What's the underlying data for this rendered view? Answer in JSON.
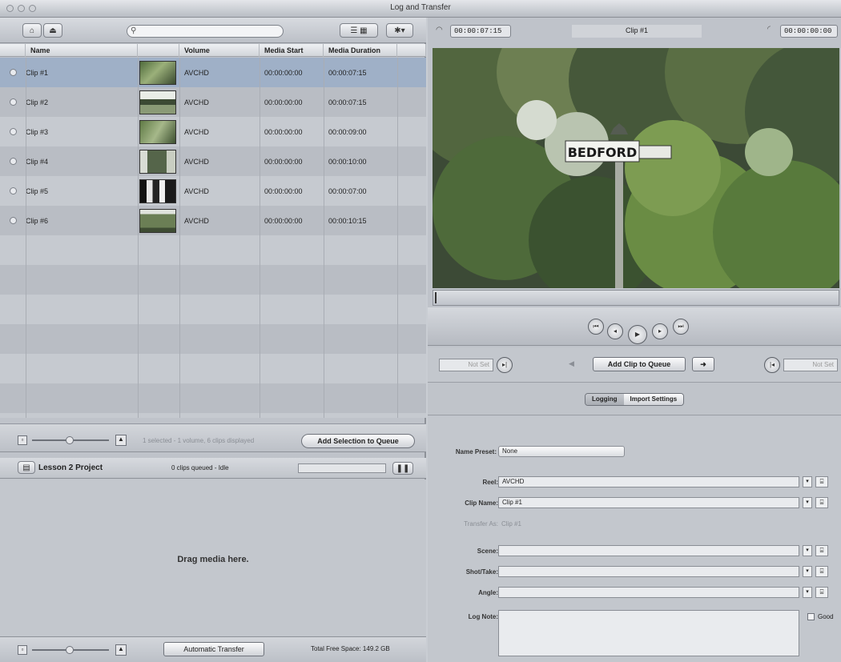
{
  "window": {
    "title": "Log and Transfer"
  },
  "browser": {
    "columns": [
      "Name",
      "",
      "Volume",
      "Media Start",
      "Media Duration"
    ],
    "clips": [
      {
        "name": "Clip #1",
        "volume": "AVCHD",
        "media_start": "00:00:00:00",
        "media_duration": "00:00:07:15",
        "selected": true
      },
      {
        "name": "Clip #2",
        "volume": "AVCHD",
        "media_start": "00:00:00:00",
        "media_duration": "00:00:07:15"
      },
      {
        "name": "Clip #3",
        "volume": "AVCHD",
        "media_start": "00:00:00:00",
        "media_duration": "00:00:09:00"
      },
      {
        "name": "Clip #4",
        "volume": "AVCHD",
        "media_start": "00:00:00:00",
        "media_duration": "00:00:10:00"
      },
      {
        "name": "Clip #5",
        "volume": "AVCHD",
        "media_start": "00:00:00:00",
        "media_duration": "00:00:07:00"
      },
      {
        "name": "Clip #6",
        "volume": "AVCHD",
        "media_start": "00:00:00:00",
        "media_duration": "00:00:10:15"
      }
    ],
    "status": "1 selected - 1 volume, 6 clips displayed",
    "add_selection_label": "Add Selection to Queue"
  },
  "queue": {
    "project_name": "Lesson 2 Project",
    "queued_status": "0 clips queued - Idle",
    "drop_hint": "Drag media here.",
    "auto_transfer_label": "Automatic Transfer",
    "free_space": "Total Free Space: 149.2 GB"
  },
  "viewer": {
    "timecode_duration": "00:00:07:15",
    "clip_name": "Clip #1",
    "timecode_current": "00:00:00:00",
    "sign_text": "BEDFORD",
    "mark_in_placeholder": "Not Set",
    "mark_out_placeholder": "Not Set",
    "add_clip_label": "Add Clip to Queue"
  },
  "logging": {
    "tabs": [
      "Logging",
      "Import Settings"
    ],
    "active_tab": "Logging",
    "name_preset_label": "Name Preset:",
    "name_preset_value": "None",
    "reel_label": "Reel:",
    "reel_value": "AVCHD",
    "clip_name_label": "Clip Name:",
    "clip_name_value": "Clip #1",
    "transfer_as_label": "Transfer As:",
    "transfer_as_value": "Clip #1",
    "scene_label": "Scene:",
    "shot_take_label": "Shot/Take:",
    "angle_label": "Angle:",
    "log_note_label": "Log Note:",
    "good_label": "Good"
  }
}
